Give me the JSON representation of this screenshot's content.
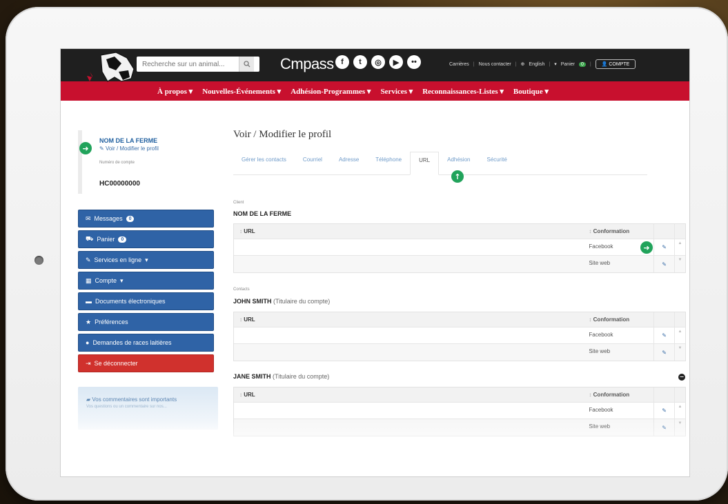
{
  "search": {
    "placeholder": "Recherche sur un animal..."
  },
  "brand": {
    "name": "Cmpass"
  },
  "social": [
    {
      "icon": "facebook-icon",
      "glyph": "f"
    },
    {
      "icon": "twitter-icon",
      "glyph": "t"
    },
    {
      "icon": "instagram-icon",
      "glyph": "◎"
    },
    {
      "icon": "youtube-icon",
      "glyph": "▶"
    },
    {
      "icon": "flickr-icon",
      "glyph": "••"
    }
  ],
  "toplinks": {
    "careers": "Carrières",
    "contact": "Nous contacter",
    "language": "English",
    "cart": "Panier",
    "cart_count": "0",
    "account": "COMPTE"
  },
  "nav": [
    "À propos",
    "Nouvelles-Événements",
    "Adhésion-Programmes",
    "Services",
    "Reconnaissances-Listes",
    "Boutique"
  ],
  "farm": {
    "name": "NOM DE LA FERME",
    "edit_link": "Voir / Modifier le profil",
    "account_label": "Numéro de compte",
    "account_number": "HC00000000"
  },
  "menu": [
    {
      "label": "Messages",
      "icon": "envelope-icon",
      "glyph": "✉",
      "badge": "0"
    },
    {
      "label": "Panier",
      "icon": "cart-icon",
      "glyph": "🛒",
      "badge": "0"
    },
    {
      "label": "Services en ligne",
      "icon": "wrench-icon",
      "glyph": "✎",
      "caret": "▾"
    },
    {
      "label": "Compte",
      "icon": "table-icon",
      "glyph": "▦",
      "caret": "▾"
    },
    {
      "label": "Documents électroniques",
      "icon": "folder-icon",
      "glyph": "▬"
    },
    {
      "label": "Préférences",
      "icon": "star-icon",
      "glyph": "★"
    },
    {
      "label": "Demandes de races laitières",
      "icon": "bullet-icon",
      "glyph": "●"
    }
  ],
  "logout": {
    "label": "Se déconnecter",
    "glyph": "⇥"
  },
  "feedback": {
    "title": "Vos commentaires sont importants",
    "subtitle": "Vos questions ou un commentaire sur nos..."
  },
  "page_title": "Voir / Modifier le profil",
  "tabs": [
    {
      "label": "Gérer les contacts",
      "active": false
    },
    {
      "label": "Courriel",
      "active": false
    },
    {
      "label": "Adresse",
      "active": false
    },
    {
      "label": "Téléphone",
      "active": false
    },
    {
      "label": "URL",
      "active": true
    },
    {
      "label": "Adhésion",
      "active": false
    },
    {
      "label": "Sécurité",
      "active": false
    }
  ],
  "sections": [
    {
      "label": "Client",
      "name": "NOM DE LA FERME",
      "role": "",
      "col_url": "URL",
      "col_conf": "Conformation",
      "rows": [
        {
          "url": "",
          "type": "Facebook"
        },
        {
          "url": "",
          "type": "Site web"
        }
      ]
    },
    {
      "label": "Contacts",
      "name": "JOHN SMITH",
      "role": "(Titulaire du compte)",
      "col_url": "URL",
      "col_conf": "Conformation",
      "rows": [
        {
          "url": "",
          "type": "Facebook"
        },
        {
          "url": "",
          "type": "Site web"
        }
      ]
    },
    {
      "label": "",
      "name": "JANE SMITH",
      "role": "(Titulaire du compte)",
      "col_url": "URL",
      "col_conf": "Conformation",
      "rows": [
        {
          "url": "",
          "type": "Facebook"
        },
        {
          "url": "",
          "type": "Site web"
        }
      ]
    }
  ],
  "colors": {
    "nav_red": "#c8102e",
    "button_blue": "#2f63a6",
    "logout_red": "#d0312d",
    "accent_green": "#21a35b"
  }
}
